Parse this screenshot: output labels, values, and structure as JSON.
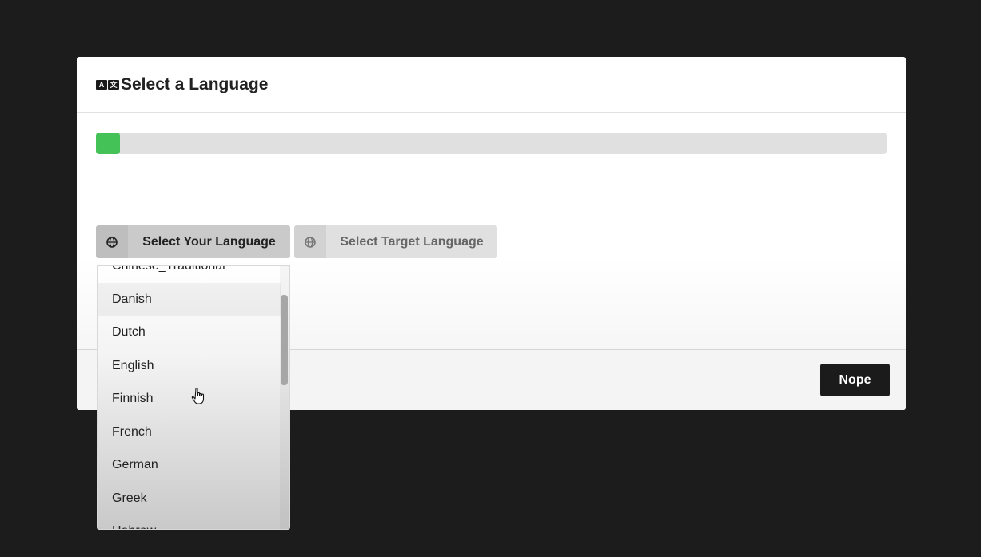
{
  "dialog": {
    "title": "Select a Language",
    "title_icon": "translate-icon",
    "title_icon_glyphs": [
      "A",
      "文"
    ],
    "progress": 0.03,
    "progress_color": "#44c258"
  },
  "buttons": {
    "your_language": {
      "label": "Select Your Language",
      "icon": "globe-icon"
    },
    "target_language": {
      "label": "Select Target Language",
      "icon": "globe-icon"
    },
    "nope": "Nope"
  },
  "dropdown": {
    "options": [
      "Chinese_Traditional",
      "Danish",
      "Dutch",
      "English",
      "Finnish",
      "French",
      "German",
      "Greek",
      "Hebrew"
    ],
    "hovered": "Danish"
  },
  "colors": {
    "background": "#1c1c1c",
    "dialog": "#ffffff",
    "primary_button": "#1b1b1b"
  }
}
